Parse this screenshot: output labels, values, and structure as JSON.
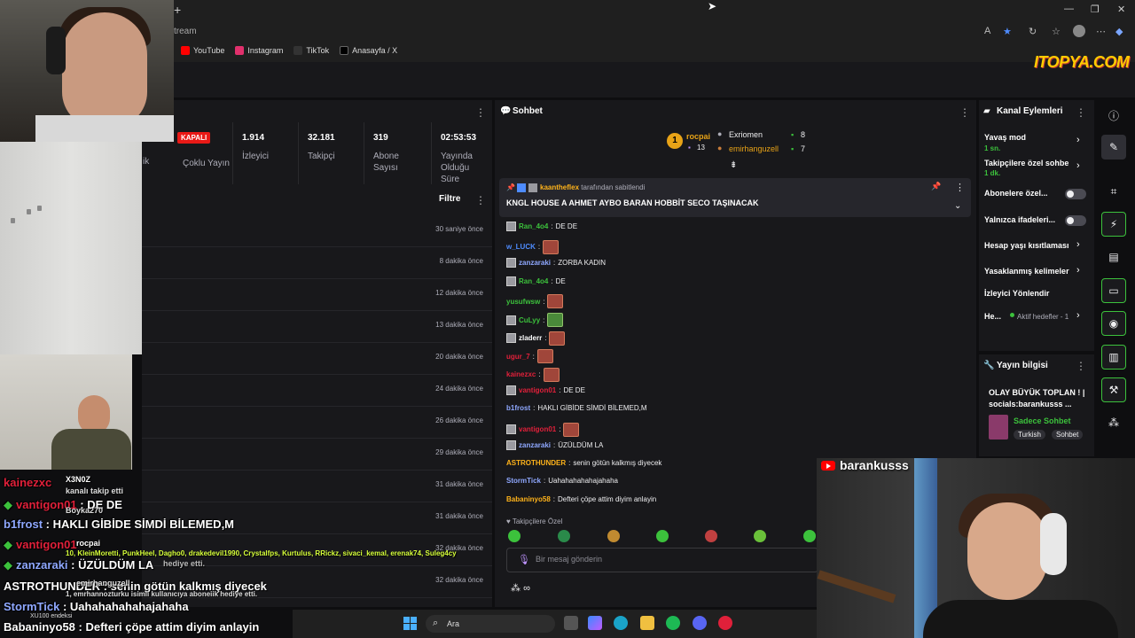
{
  "browser": {
    "address": "tream",
    "bookmarks": [
      {
        "label": "YouTube",
        "color": "#ff0000"
      },
      {
        "label": "Instagram",
        "color": "#e1306c"
      },
      {
        "label": "TikTok",
        "color": "#222222"
      },
      {
        "label": "Anasayfa / X",
        "color": "#111111"
      }
    ]
  },
  "watermark": "ITOPYA.COM",
  "status": {
    "offline_badge": "KAPALI",
    "partial_label": "ik",
    "stats": [
      {
        "value": "",
        "label": "Çoklu Yayın"
      },
      {
        "value": "1.914",
        "label": "İzleyici"
      },
      {
        "value": "32.181",
        "label": "Takipçi"
      },
      {
        "value": "319",
        "label": "Abone Sayısı"
      },
      {
        "value": "02:53:53",
        "label": "Yayında Olduğu Süre"
      }
    ]
  },
  "activity": {
    "filter_label": "Filtre",
    "times": [
      "30 saniye önce",
      "8 dakika önce",
      "12 dakika önce",
      "13 dakika önce",
      "20 dakika önce",
      "24 dakika önce",
      "26 dakika önce",
      "29 dakika önce",
      "31 dakika önce",
      "31 dakika önce",
      "32 dakika önce",
      "32 dakika önce"
    ]
  },
  "chat": {
    "title": "Sohbet",
    "leaderboard": {
      "first_name": "rocpai",
      "first_count": "13",
      "second_name": "Exriomen",
      "second_count": "8",
      "third_name": "emirhanguzell",
      "third_count": "7"
    },
    "pinned": {
      "user": "kaantheflex",
      "by_text": "tarafından sabitlendi",
      "message": "KNGL HOUSE A AHMET AYBO BARAN HOBBİT SECO TAŞINACAK"
    },
    "messages": [
      {
        "user": "Ran_4o4",
        "color": "#3cc13c",
        "text": "DE DE",
        "badge": true,
        "emote": false
      },
      {
        "user": "w_LUCK",
        "color": "#4e8cff",
        "text": "",
        "badge": false,
        "emote": true
      },
      {
        "user": "zanzaraki",
        "color": "#8fa8ff",
        "text": "ZORBA KADIN",
        "badge": true,
        "emote": false
      },
      {
        "user": "Ran_4o4",
        "color": "#3cc13c",
        "text": "DE",
        "badge": true,
        "emote": false
      },
      {
        "user": "yusufwsw",
        "color": "#3cc13c",
        "text": "",
        "badge": false,
        "emote": true
      },
      {
        "user": "CuLyy",
        "color": "#3cc13c",
        "text": "",
        "badge": true,
        "emote": true
      },
      {
        "user": "zladerr",
        "color": "#ffffff",
        "text": "",
        "badge": true,
        "emote": true
      },
      {
        "user": "ugur_7",
        "color": "#e0203a",
        "text": "",
        "badge": false,
        "emote": true
      },
      {
        "user": "kainezxc",
        "color": "#e0203a",
        "text": "",
        "badge": false,
        "emote": true
      },
      {
        "user": "vantigon01",
        "color": "#e0203a",
        "text": "DE DE",
        "badge": true,
        "emote": false
      },
      {
        "user": "b1frost",
        "color": "#8fa8ff",
        "text": "HAKLI GİBİDE SİMDİ BİLEMED,M",
        "badge": false,
        "emote": false
      },
      {
        "user": "vantigon01",
        "color": "#e0203a",
        "text": "",
        "badge": true,
        "emote": true
      },
      {
        "user": "zanzaraki",
        "color": "#8fa8ff",
        "text": "ÜZÜLDÜM LA",
        "badge": true,
        "emote": false
      },
      {
        "user": "ASTROTHUNDER",
        "color": "#ffb31a",
        "text": "senin götün kalkmış diyecek",
        "badge": false,
        "emote": false
      },
      {
        "user": "StormTick",
        "color": "#8fa8ff",
        "text": "Uahahahahahajahaha",
        "badge": false,
        "emote": false
      },
      {
        "user": "Babaninyo58",
        "color": "#ffb31a",
        "text": "Defteri çöpe attim diyim anlayin",
        "badge": false,
        "emote": false
      }
    ],
    "followers_only": "Takipçilere Özel",
    "input_placeholder": "Bir mesaj gönderin",
    "points": "∞"
  },
  "channel_actions": {
    "title": "Kanal Eylemleri",
    "slow_mode": "Yavaş mod",
    "slow_mode_sub": "1 sn.",
    "followers_chat": "Takipçilere özel sohbe",
    "followers_chat_sub": "1 dk.",
    "subs_only": "Abonelere özel...",
    "emote_only": "Yalnızca ifadeleri...",
    "age_restrict": "Hesap yaşı kısıtlaması",
    "banned_words": "Yasaklanmış kelimeler",
    "viewer_redirect": "İzleyici Yönlendir",
    "goals": "He...",
    "goals_sub": "Aktif hedefler - 1"
  },
  "stream_info": {
    "title": "Yayın bilgisi",
    "stream_title": "OLAY BÜYÜK TOPLAN ! | socials:barankusss ...",
    "category": "Sadece Sohbet",
    "tags": [
      "Turkish",
      "Sohbet"
    ]
  },
  "overlay_chat": [
    {
      "user": "kainezxc",
      "text": "",
      "style": "red"
    },
    {
      "user": "vantigon01",
      "text": "DE DE",
      "style": "red"
    },
    {
      "user": "b1frost",
      "text": "HAKLI GİBİDE SİMDİ BİLEMED,M",
      "style": "blue"
    },
    {
      "user": "vantigon01",
      "text": "",
      "style": "red"
    },
    {
      "user": "zanzaraki",
      "text": "ÜZÜLDÜM LA",
      "style": "blue"
    },
    {
      "user": "ASTROTHUNDER",
      "text": "senin götün kalkmış diyecek",
      "style": "gold"
    },
    {
      "user": "StormTick",
      "text": "Uahahahahahajahaha",
      "style": "blue"
    },
    {
      "user": "Babaninyo58",
      "text": "Defteri çöpe attim diyim anlayin",
      "style": "gold"
    }
  ],
  "overlay_events": {
    "follow_user": "X3N0Z",
    "follow_text": "kanalı takip etti",
    "sub_user": "Boyka270",
    "gift_user": "rocpai",
    "gift_names": "10, KleinMoretti, PunkHeel, Dagho0, drakedevil1990, Crystalfps, Kurtulus, RRickz, sivaci_kemal, erenak74, Suleg4cy",
    "gift_text": "hediye etti.",
    "gift2_user": "emirhanguzell",
    "gift2_text": "1, emrhannozturku isimli kullanıcıya aboneiik hediye etti."
  },
  "youtube_overlay": "barankusss",
  "taskbar": {
    "search": "Ara",
    "ticker": "XU100 endeksi"
  }
}
